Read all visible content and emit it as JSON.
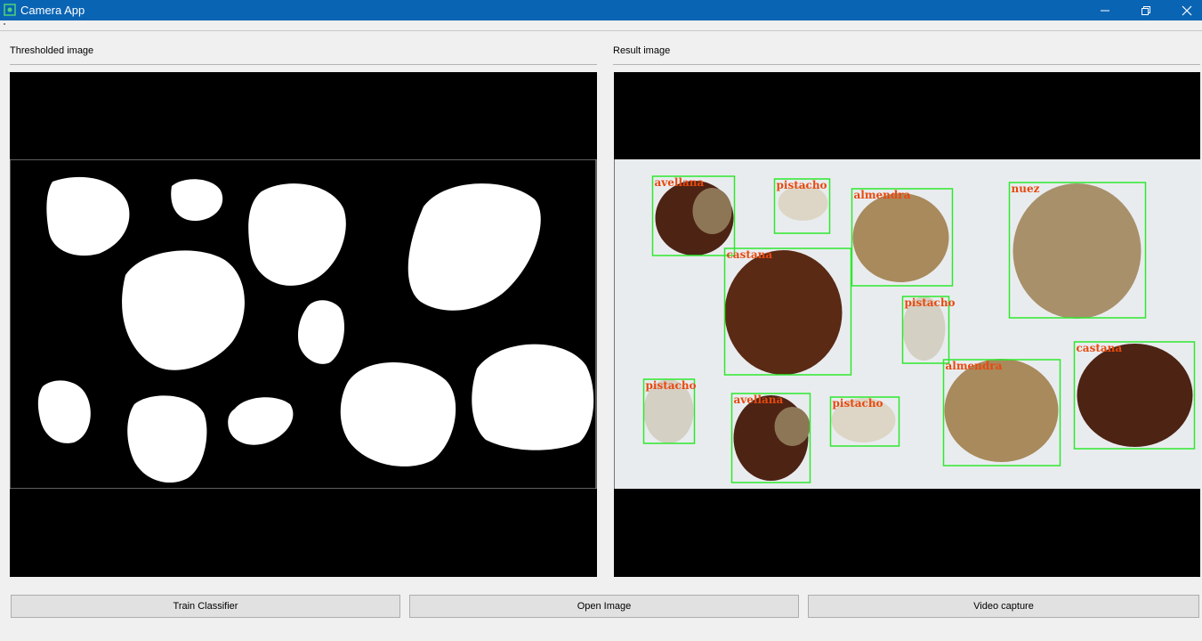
{
  "window": {
    "title": "Camera App",
    "colors": {
      "titlebar": "#0a64b4",
      "box": "#2ee82e",
      "label": "#e8490f"
    }
  },
  "panels": {
    "left_label": "Thresholded image",
    "right_label": "Result image"
  },
  "detections": [
    {
      "label": "avellana"
    },
    {
      "label": "pistacho"
    },
    {
      "label": "almendra"
    },
    {
      "label": "nuez"
    },
    {
      "label": "castana"
    },
    {
      "label": "pistacho"
    },
    {
      "label": "almendra"
    },
    {
      "label": "castana"
    },
    {
      "label": "pistacho"
    },
    {
      "label": "avellana"
    },
    {
      "label": "pistacho"
    }
  ],
  "buttons": {
    "train": "Train Classifier",
    "open": "Open Image",
    "video": "Video capture"
  }
}
